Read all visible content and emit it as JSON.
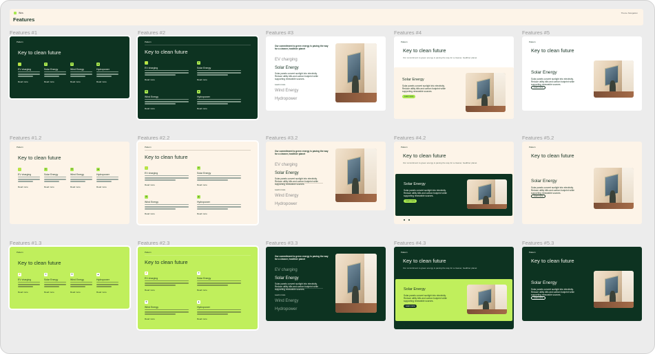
{
  "brand": {
    "name": "Wcs"
  },
  "page": {
    "title": "Features"
  },
  "topnav": {
    "label": "Theme Navigation"
  },
  "common": {
    "link": "Read more",
    "nav_label": "Pattern",
    "heading": "Key to clean future",
    "intro": "Our commitment to green energy is paving the way for a cleaner, healthier planet",
    "solar": "Solar Energy",
    "solar_text": "Solar panels convert sunlight into electricity. Reduce utility bills and carbon footprint while supporting renewable sources.",
    "cta": "Learn more",
    "features": [
      "EV charging",
      "Solar Energy",
      "Wind Energy",
      "Hydropower"
    ]
  },
  "labels": [
    "Features #1",
    "Features #2",
    "Features #3",
    "Features #4",
    "Features #5",
    "Features #1.2",
    "Features #2.2",
    "Features #3.2",
    "Features #4.2",
    "Features #5.2",
    "Features #1.3",
    "Features #2.3",
    "Features #3.3",
    "Features #4.3",
    "Features #5.3"
  ],
  "colors": {
    "dark_green": "#0d3321",
    "lime": "#c0ef5c",
    "cream": "#fdf4e8",
    "accent": "#a9e84e"
  },
  "icons": [
    "ev-plug-icon",
    "solar-panel-icon",
    "wind-turbine-icon",
    "hydro-drop-icon"
  ]
}
